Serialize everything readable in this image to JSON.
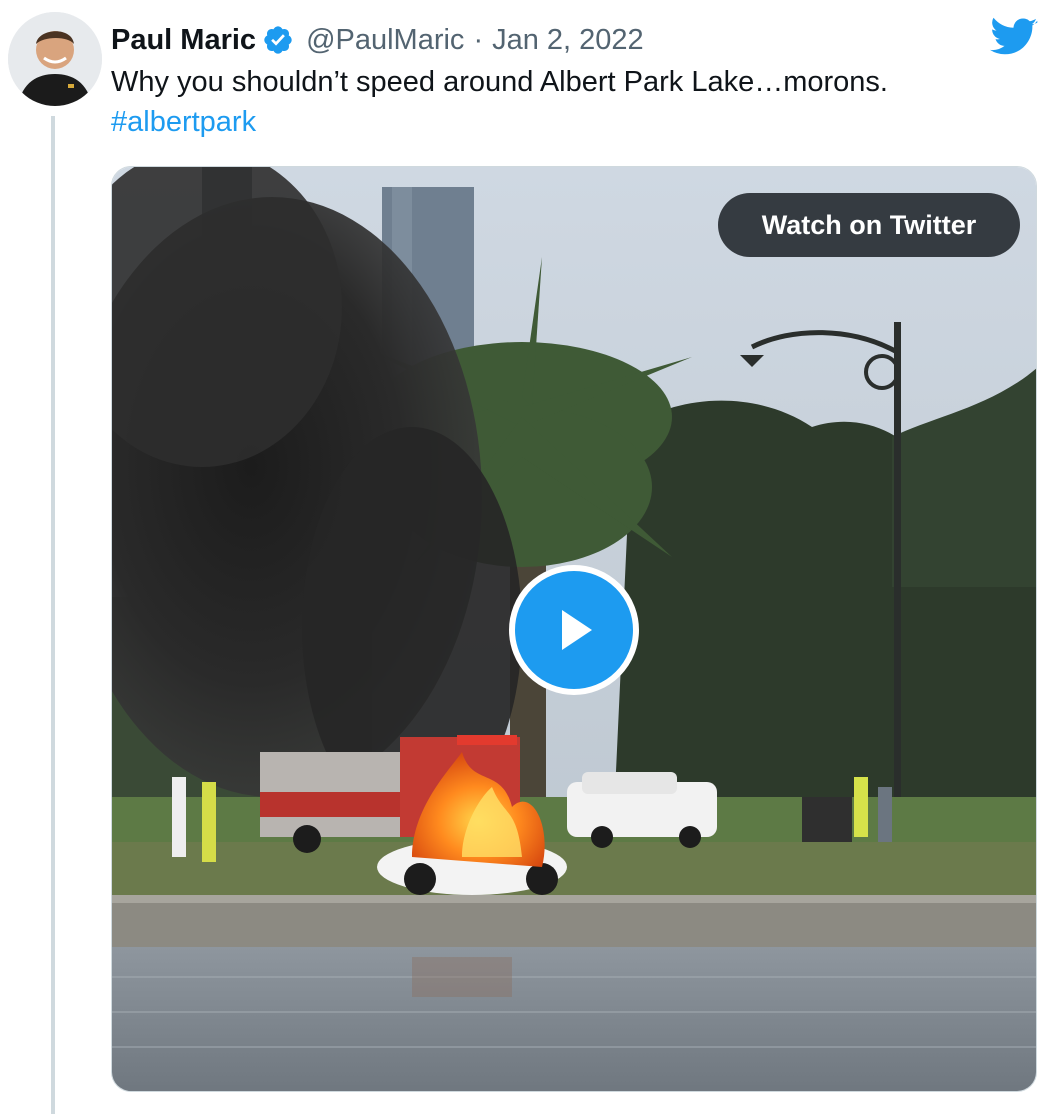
{
  "author": {
    "display_name": "Paul Maric",
    "handle": "@PaulMaric",
    "separator": "·",
    "date": "Jan 2, 2022",
    "verified": true
  },
  "tweet": {
    "text": "Why you shouldn’t speed around Albert Park Lake…morons.",
    "hashtag": "#albertpark"
  },
  "media": {
    "watch_label": "Watch on Twitter",
    "play_icon": "play-icon"
  },
  "icons": {
    "brand": "twitter-bird-icon",
    "verified": "verified-badge-icon"
  },
  "colors": {
    "accent": "#1d9bf0",
    "text": "#0f1419",
    "muted": "#536471"
  }
}
